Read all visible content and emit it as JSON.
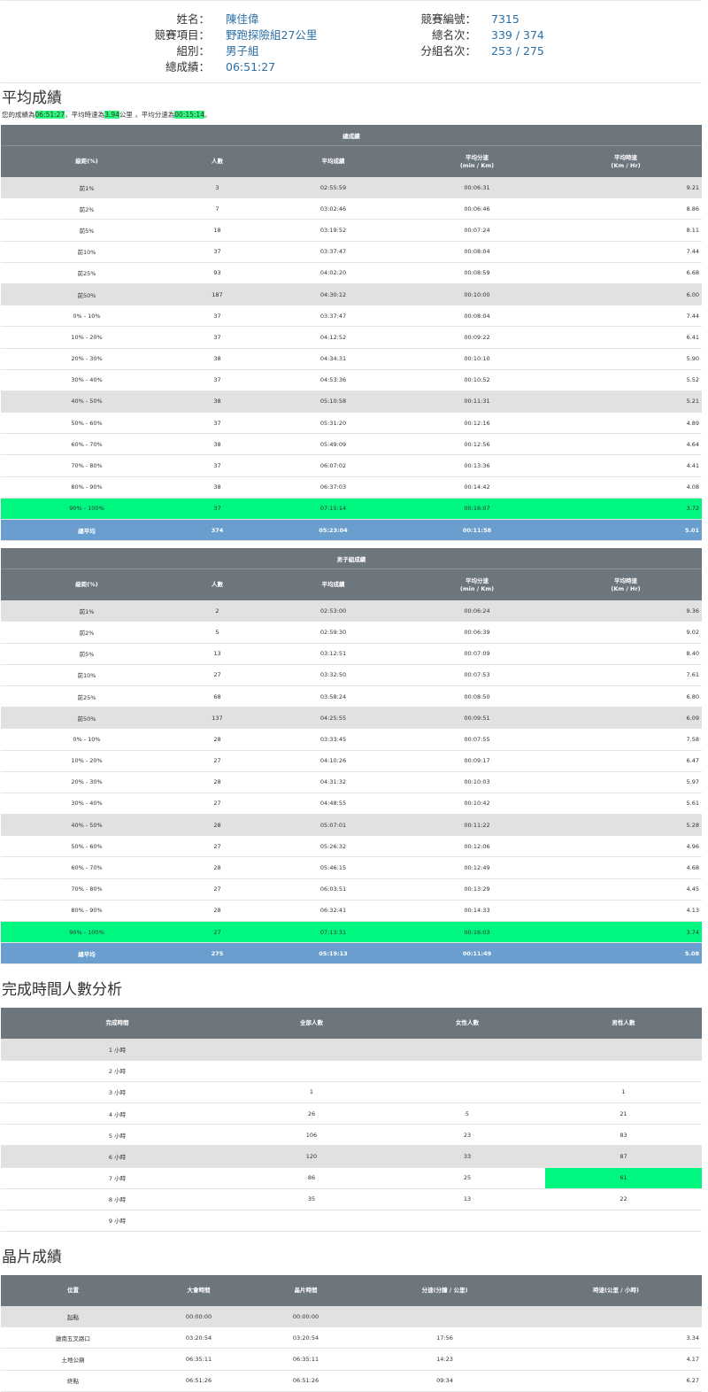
{
  "runner": {
    "name_label": "姓名：",
    "name": "陳佳偉",
    "event_label": "競賽項目：",
    "event": "野跑探險組27公里",
    "group_label": "組別：",
    "group": "男子組",
    "total_time_label": "總成績：",
    "total_time": "06:51:27",
    "bib_label": "競賽編號：",
    "bib": "7315",
    "overall_rank_label": "總名次：",
    "overall_rank": "339 / 374",
    "group_rank_label": "分組名次：",
    "group_rank": "253 / 275"
  },
  "avg_section": {
    "title": "平均成績",
    "note": {
      "p1": "您的成績為",
      "time": "06:51:27",
      "p2": "，平均時速為",
      "speed": "3.94",
      "p3": "公里 ，平均分速為",
      "pace": "00:15:14",
      "p4": "。"
    }
  },
  "overall_table": {
    "caption": "總成績",
    "headers": [
      "級距(%)",
      "人數",
      "平均成績",
      "平均分速\n(min / Km)",
      "平均時速\n(Km / Hr)"
    ],
    "rows": [
      {
        "c": [
          "前1%",
          "3",
          "02:55:59",
          "00:06:31",
          "9.21"
        ],
        "style": "gray"
      },
      {
        "c": [
          "前2%",
          "7",
          "03:02:46",
          "00:06:46",
          "8.86"
        ],
        "style": ""
      },
      {
        "c": [
          "前5%",
          "18",
          "03:19:52",
          "00:07:24",
          "8.11"
        ],
        "style": ""
      },
      {
        "c": [
          "前10%",
          "37",
          "03:37:47",
          "00:08:04",
          "7.44"
        ],
        "style": ""
      },
      {
        "c": [
          "前25%",
          "93",
          "04:02:20",
          "00:08:59",
          "6.68"
        ],
        "style": ""
      },
      {
        "c": [
          "前50%",
          "187",
          "04:30:12",
          "00:10:00",
          "6.00"
        ],
        "style": "gray"
      },
      {
        "c": [
          "0% - 10%",
          "37",
          "03:37:47",
          "00:08:04",
          "7.44"
        ],
        "style": ""
      },
      {
        "c": [
          "10% - 20%",
          "37",
          "04:12:52",
          "00:09:22",
          "6.41"
        ],
        "style": ""
      },
      {
        "c": [
          "20% - 30%",
          "38",
          "04:34:31",
          "00:10:10",
          "5.90"
        ],
        "style": ""
      },
      {
        "c": [
          "30% - 40%",
          "37",
          "04:53:36",
          "00:10:52",
          "5.52"
        ],
        "style": ""
      },
      {
        "c": [
          "40% - 50%",
          "38",
          "05:10:58",
          "00:11:31",
          "5.21"
        ],
        "style": "gray"
      },
      {
        "c": [
          "50% - 60%",
          "37",
          "05:31:20",
          "00:12:16",
          "4.89"
        ],
        "style": ""
      },
      {
        "c": [
          "60% - 70%",
          "38",
          "05:49:09",
          "00:12:56",
          "4.64"
        ],
        "style": ""
      },
      {
        "c": [
          "70% - 80%",
          "37",
          "06:07:02",
          "00:13:36",
          "4.41"
        ],
        "style": ""
      },
      {
        "c": [
          "80% - 90%",
          "38",
          "06:37:03",
          "00:14:42",
          "4.08"
        ],
        "style": ""
      },
      {
        "c": [
          "90% - 100%",
          "37",
          "07:15:14",
          "00:16:07",
          "3.72"
        ],
        "style": "green"
      },
      {
        "c": [
          "總平均",
          "374",
          "05:23:04",
          "00:11:58",
          "5.01"
        ],
        "style": "blue"
      }
    ]
  },
  "male_table": {
    "caption": "男子組成績",
    "headers": [
      "級距(%)",
      "人數",
      "平均成績",
      "平均分速\n(min / Km)",
      "平均時速\n(Km / Hr)"
    ],
    "rows": [
      {
        "c": [
          "前1%",
          "2",
          "02:53:00",
          "00:06:24",
          "9.36"
        ],
        "style": "gray"
      },
      {
        "c": [
          "前2%",
          "5",
          "02:59:30",
          "00:06:39",
          "9.02"
        ],
        "style": ""
      },
      {
        "c": [
          "前5%",
          "13",
          "03:12:51",
          "00:07:09",
          "8.40"
        ],
        "style": ""
      },
      {
        "c": [
          "前10%",
          "27",
          "03:32:50",
          "00:07:53",
          "7.61"
        ],
        "style": ""
      },
      {
        "c": [
          "前25%",
          "68",
          "03:58:24",
          "00:08:50",
          "6.80"
        ],
        "style": ""
      },
      {
        "c": [
          "前50%",
          "137",
          "04:25:55",
          "00:09:51",
          "6.09"
        ],
        "style": "gray"
      },
      {
        "c": [
          "0% - 10%",
          "28",
          "03:33:45",
          "00:07:55",
          "7.58"
        ],
        "style": ""
      },
      {
        "c": [
          "10% - 20%",
          "27",
          "04:10:26",
          "00:09:17",
          "6.47"
        ],
        "style": ""
      },
      {
        "c": [
          "20% - 30%",
          "28",
          "04:31:32",
          "00:10:03",
          "5.97"
        ],
        "style": ""
      },
      {
        "c": [
          "30% - 40%",
          "27",
          "04:48:55",
          "00:10:42",
          "5.61"
        ],
        "style": ""
      },
      {
        "c": [
          "40% - 50%",
          "28",
          "05:07:01",
          "00:11:22",
          "5.28"
        ],
        "style": "gray"
      },
      {
        "c": [
          "50% - 60%",
          "27",
          "05:26:32",
          "00:12:06",
          "4.96"
        ],
        "style": ""
      },
      {
        "c": [
          "60% - 70%",
          "28",
          "05:46:15",
          "00:12:49",
          "4.68"
        ],
        "style": ""
      },
      {
        "c": [
          "70% - 80%",
          "27",
          "06:03:51",
          "00:13:29",
          "4.45"
        ],
        "style": ""
      },
      {
        "c": [
          "80% - 90%",
          "28",
          "06:32:41",
          "00:14:33",
          "4.13"
        ],
        "style": ""
      },
      {
        "c": [
          "90% - 100%",
          "27",
          "07:13:31",
          "00:16:03",
          "3.74"
        ],
        "style": "green"
      },
      {
        "c": [
          "總平均",
          "275",
          "05:19:13",
          "00:11:49",
          "5.08"
        ],
        "style": "blue"
      }
    ]
  },
  "finish_section": {
    "title": "完成時間人數分析",
    "headers": [
      "完成時間",
      "全部人數",
      "女性人數",
      "男性人數"
    ],
    "rows": [
      {
        "c": [
          "1 小時",
          "",
          "",
          ""
        ],
        "style": "gray"
      },
      {
        "c": [
          "2 小時",
          "",
          "",
          ""
        ],
        "style": ""
      },
      {
        "c": [
          "3 小時",
          "1",
          "",
          "1"
        ],
        "style": ""
      },
      {
        "c": [
          "4 小時",
          "26",
          "5",
          "21"
        ],
        "style": ""
      },
      {
        "c": [
          "5 小時",
          "106",
          "23",
          "83"
        ],
        "style": ""
      },
      {
        "c": [
          "6 小時",
          "120",
          "33",
          "87"
        ],
        "style": "gray"
      },
      {
        "c": [
          "7 小時",
          "86",
          "25",
          "61"
        ],
        "style": "",
        "hl": 3
      },
      {
        "c": [
          "8 小時",
          "35",
          "13",
          "22"
        ],
        "style": ""
      },
      {
        "c": [
          "9 小時",
          "",
          "",
          ""
        ],
        "style": ""
      }
    ]
  },
  "chip_section": {
    "title": "晶片成績",
    "headers": [
      "位置",
      "大會時間",
      "晶片時間",
      "分速(分鐘 / 公里)",
      "時速(公里 / 小時)"
    ],
    "rows": [
      {
        "c": [
          "起點",
          "00:00:00",
          "00:00:00",
          "",
          ""
        ],
        "style": "gray"
      },
      {
        "c": [
          "雞南五叉路口",
          "03:20:54",
          "03:20:54",
          "17:56",
          "3.34"
        ],
        "style": ""
      },
      {
        "c": [
          "土地公廟",
          "06:35:11",
          "06:35:11",
          "14:23",
          "4.17"
        ],
        "style": ""
      },
      {
        "c": [
          "終點",
          "06:51:26",
          "06:51:26",
          "09:34",
          "6.27"
        ],
        "style": ""
      }
    ]
  },
  "colors": {
    "header_gray": "#6d757d",
    "highlight_green": "#00f77f",
    "total_blue": "#6a9ecf",
    "link_blue": "#2b6fa6"
  }
}
